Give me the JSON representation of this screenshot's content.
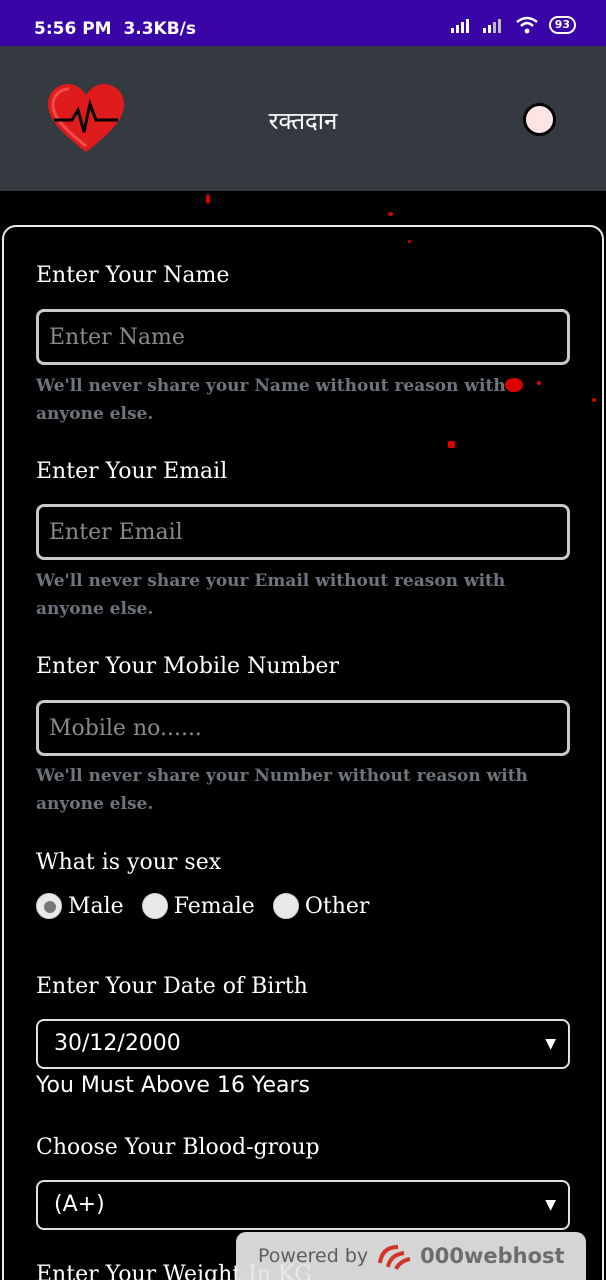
{
  "status_bar": {
    "time": "5:56 PM",
    "speed": "3.3KB/s",
    "battery": "93"
  },
  "header": {
    "title": "रक्तदान",
    "logo_icon": "heart-pulse-icon",
    "accent": "#e01b1b"
  },
  "form": {
    "name": {
      "label": "Enter Your Name",
      "placeholder": "Enter Name",
      "help": "We'll never share your Name without reason with anyone else."
    },
    "email": {
      "label": "Enter Your Email",
      "placeholder": "Enter Email",
      "help": "We'll never share your Email without reason with anyone else."
    },
    "mobile": {
      "label": "Enter Your Mobile Number",
      "placeholder": "Mobile no......",
      "help": "We'll never share your Number without reason with anyone else."
    },
    "sex": {
      "label": "What is your sex",
      "options": [
        "Male",
        "Female",
        "Other"
      ],
      "selected": "Male"
    },
    "dob": {
      "label": "Enter Your Date of Birth",
      "value": "30/12/2000",
      "note": "You Must Above 16 Years"
    },
    "blood": {
      "label": "Choose Your Blood-group",
      "value": "(A+)"
    },
    "weight": {
      "label": "Enter Your Weight In KG"
    }
  },
  "footer": {
    "powered_by": "Powered by",
    "brand": "000webhost"
  }
}
